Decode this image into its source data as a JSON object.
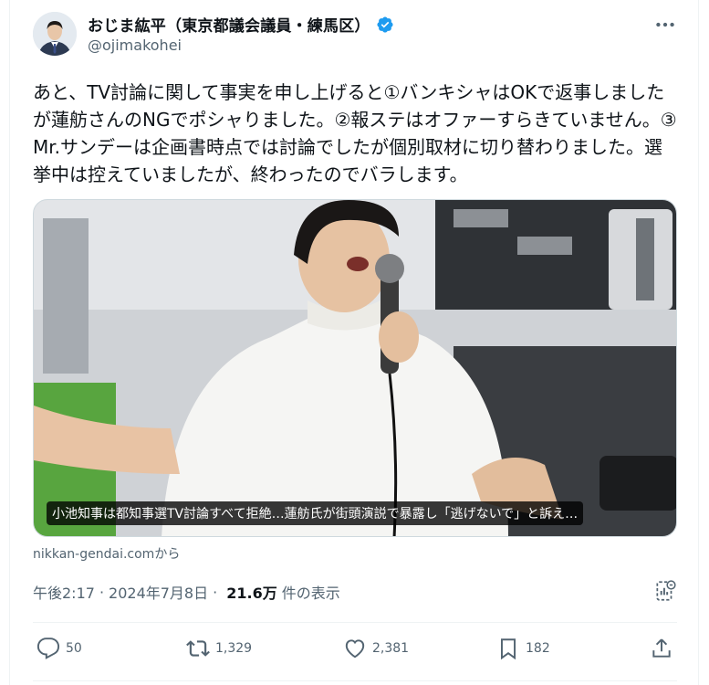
{
  "user": {
    "display_name": "おじま紘平（東京都議会議員・練馬区）",
    "handle": "@ojimakohei"
  },
  "post": {
    "text": "あと、TV討論に関して事実を申し上げると①バンキシャはOKで返事しましたが蓮舫さんのNGでポシャりました。②報ステはオファーすらきていません。③Mr.サンデーは企画書時点では討論でしたが個別取材に切り替わりました。選挙中は控えていましたが、終わったのでバラします。",
    "link_card_caption": "小池知事は都知事選TV討論すべて拒絶…蓮舫氏が街頭演説で暴露し「逃げないで」と訴え…",
    "source": "nikkan-gendai.comから",
    "time": "午後2:17",
    "date": "2024年7月8日",
    "views_count": "21.6万",
    "views_label": "件の表示"
  },
  "actions": {
    "replies": "50",
    "reposts": "1,329",
    "likes": "2,381",
    "bookmarks": "182"
  },
  "colors": {
    "verified": "#1d9bf0",
    "text": "#0f1419",
    "muted": "#536471",
    "border": "#eff3f4"
  },
  "icons": [
    "verified-badge-icon",
    "more-icon",
    "analytics-icon",
    "reply-icon",
    "repost-icon",
    "like-icon",
    "bookmark-icon",
    "share-icon"
  ]
}
